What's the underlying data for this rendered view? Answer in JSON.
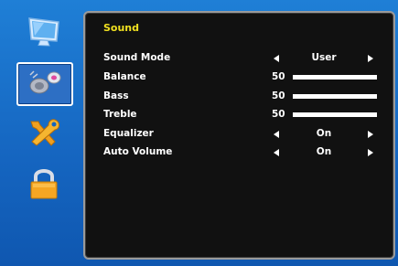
{
  "sidebar": {
    "items": [
      {
        "name": "picture-menu-icon"
      },
      {
        "name": "sound-menu-icon",
        "selected": true
      },
      {
        "name": "setup-menu-icon"
      },
      {
        "name": "lock-menu-icon"
      }
    ]
  },
  "panel": {
    "title": "Sound",
    "rows": [
      {
        "label": "Sound Mode",
        "type": "select",
        "value": "User"
      },
      {
        "label": "Balance",
        "type": "slider",
        "value": "50",
        "level": 1.0
      },
      {
        "label": "Bass",
        "type": "slider",
        "value": "50",
        "level": 1.0
      },
      {
        "label": "Treble",
        "type": "slider",
        "value": "50",
        "level": 1.0
      },
      {
        "label": "Equalizer",
        "type": "select",
        "value": "On"
      },
      {
        "label": "Auto Volume",
        "type": "select",
        "value": "On"
      }
    ]
  },
  "colors": {
    "background": "#1565c0",
    "panel": "#111111",
    "title": "#f0e020",
    "text": "#ffffff"
  }
}
